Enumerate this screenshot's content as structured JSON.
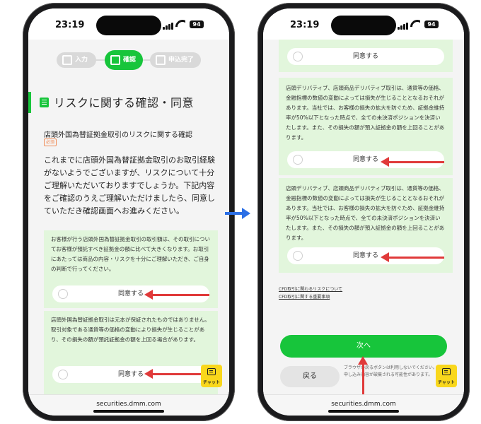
{
  "left": {
    "status": {
      "time": "23:19",
      "battery": "94"
    },
    "steps": [
      {
        "label": "入力",
        "active": false
      },
      {
        "label": "確認",
        "active": true
      },
      {
        "label": "申込完了",
        "active": false
      }
    ],
    "heading": "リスクに関する確認・同意",
    "subtitle": "店頭外国為替証拠金取引のリスクに関する確認",
    "required_badge": "必須",
    "intro": "これまでに店頭外国為替証拠金取引のお取引経験がないようでございますが、リスクについて十分ご理解いただいておりますでしょうか。下記内容をご確認のうえご理解いただけましたら、同意していただき確認画面へお進みください。",
    "panels": [
      {
        "text": "お客様が行う店頭外国為替証拠金取引の取引額は、その取引についてお客様が預託すべき証拠金の額に比べて大きくなります。お取引にあたっては商品の内容・リスクを十分にご理解いただき、ご自身の判断で行ってください。",
        "agree_label": "同意する"
      },
      {
        "text": "店頭外国為替証拠金取引は元本が保証されたものではありません。取引対象である通貨等の価格の変動により損失が生じることがあり、その損失の額が預託証拠金の額を上回る場合があります。",
        "agree_label": "同意する"
      }
    ],
    "chat_label": "チャット",
    "url": "securities.dmm.com"
  },
  "right": {
    "status": {
      "time": "23:19",
      "battery": "94"
    },
    "top_agree_label": "同意する",
    "panels": [
      {
        "text": "店頭デリバティブ、店頭商品デリバティブ取引は、通貨等の価格、金融指標の数値の変動によっては損失が生じることとなるおそれがあります。当社では、お客様の損失の拡大を防ぐため、証拠金維持率が50%以下となった時点で、全ての未決済ポジションを決済いたします。また、その損失の額が預入証拠金の額を上回ることがあります。",
        "agree_label": "同意する"
      },
      {
        "text": "店頭デリバティブ、店頭商品デリバティブ取引は、通貨等の価格、金融指標の数値の変動によっては損失が生じることとなるおそれがあります。当社では、お客様の損失の拡大を防ぐため、証拠金維持率が50%以下となった時点で、全ての未決済ポジションを決済いたします。また、その損失の額が預入証拠金の額を上回ることがあります。",
        "agree_label": "同意する"
      }
    ],
    "links": [
      "CFD取引に関わるリスクについて",
      "CFD取引に関する重要事項"
    ],
    "next_label": "次へ",
    "back_label": "戻る",
    "note": "ブラウザの戻るボタンは利用しないでください。お申し込み内容が破棄される可能性があります。",
    "chat_label": "チャット",
    "url": "securities.dmm.com"
  },
  "colors": {
    "accent": "#17c53b",
    "panel": "#e2f6dc",
    "annotation_arrow": "#e03a3a",
    "transition_arrow": "#2b6fe6"
  }
}
